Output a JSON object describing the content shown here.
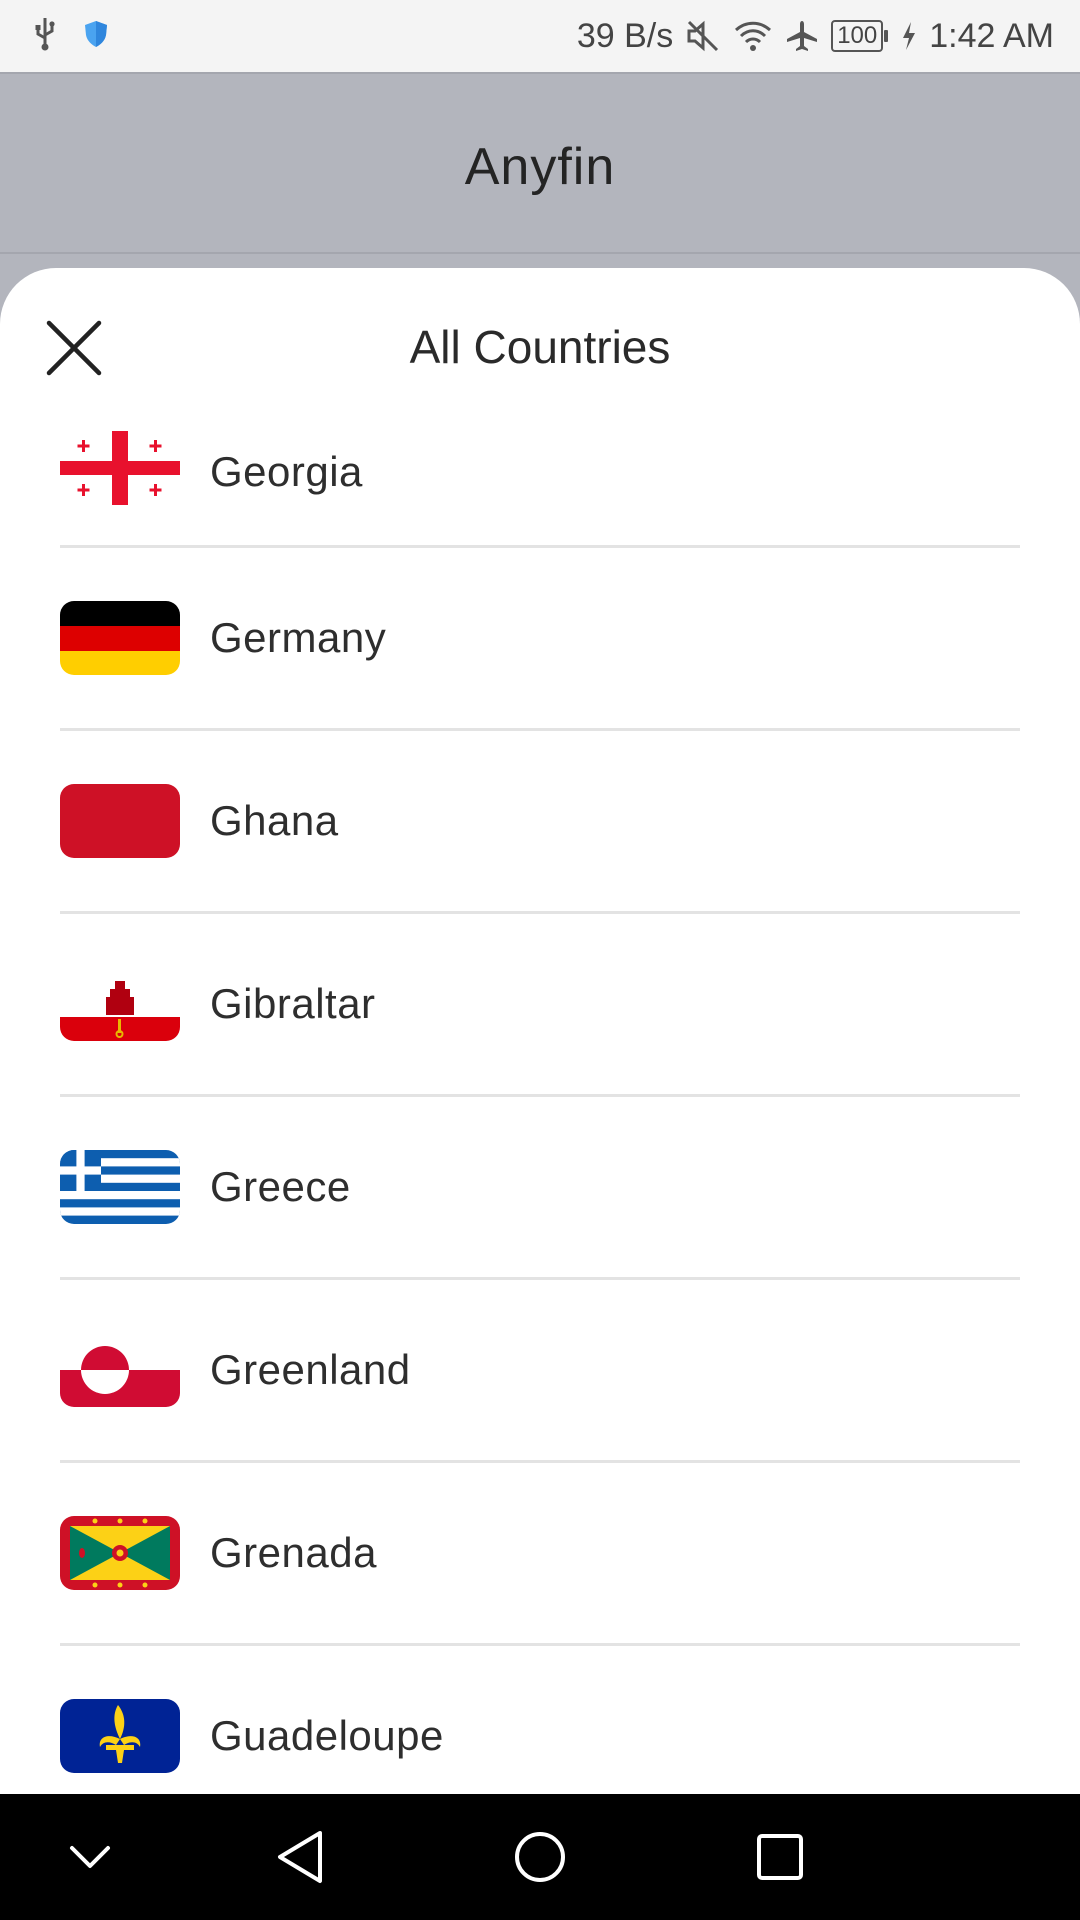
{
  "status_bar": {
    "net_speed": "39 B/s",
    "battery": "100",
    "time": "1:42 AM",
    "icons": [
      "usb-icon",
      "shield-icon",
      "mute-icon",
      "wifi-icon",
      "airplane-icon",
      "battery-icon",
      "charging-icon"
    ]
  },
  "app_bar": {
    "title": "Anyfin"
  },
  "sheet": {
    "title": "All Countries",
    "close_icon": "close-icon",
    "countries": [
      {
        "name": "Georgia",
        "flag": "georgia-flag-icon"
      },
      {
        "name": "Germany",
        "flag": "germany-flag-icon"
      },
      {
        "name": "Ghana",
        "flag": "ghana-flag-icon"
      },
      {
        "name": "Gibraltar",
        "flag": "gibraltar-flag-icon"
      },
      {
        "name": "Greece",
        "flag": "greece-flag-icon"
      },
      {
        "name": "Greenland",
        "flag": "greenland-flag-icon"
      },
      {
        "name": "Grenada",
        "flag": "grenada-flag-icon"
      },
      {
        "name": "Guadeloupe",
        "flag": "guadeloupe-flag-icon"
      }
    ]
  },
  "nav_bar": {
    "icons": [
      "chevron-down-icon",
      "back-icon",
      "home-icon",
      "recents-icon"
    ]
  },
  "colors": {
    "status_bar_bg": "#f4f4f4",
    "dim_bg": "#b3b5bd",
    "sheet_bg": "#ffffff",
    "divider": "#e3e3e3",
    "nav_bg": "#000000"
  }
}
